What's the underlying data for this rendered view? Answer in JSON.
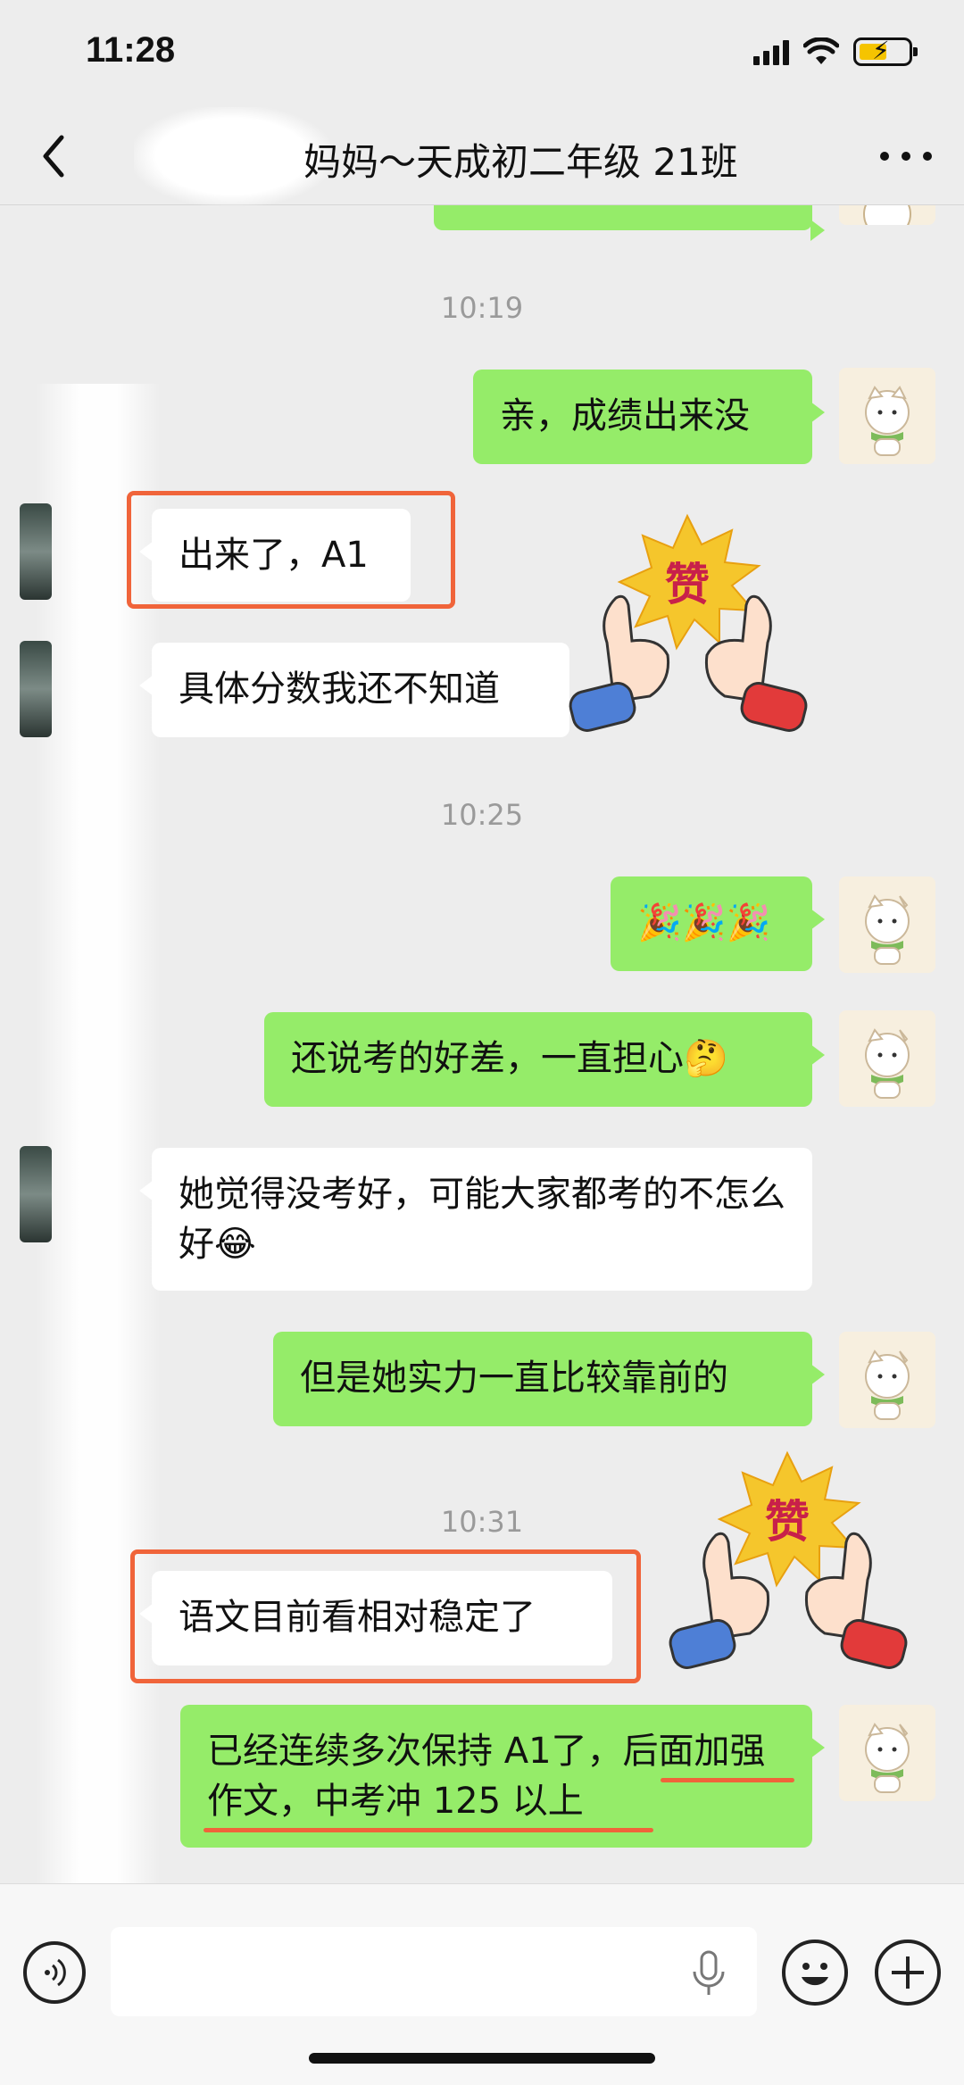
{
  "status_bar": {
    "time": "11:28"
  },
  "nav": {
    "title": "妈妈～天成初二年级 21班"
  },
  "chat": {
    "timestamps": [
      "10:19",
      "10:25",
      "10:31"
    ],
    "messages": [
      {
        "side": "out",
        "text": "亲，成绩出来没"
      },
      {
        "side": "in",
        "text": "出来了，A1",
        "highlighted": true
      },
      {
        "side": "in",
        "text": "具体分数我还不知道"
      },
      {
        "side": "out",
        "text": "🎉🎉🎉"
      },
      {
        "side": "out",
        "text": "还说考的好差，一直担心🤔"
      },
      {
        "side": "in",
        "text": "她觉得没考好，可能大家都考的不怎么好😂"
      },
      {
        "side": "out",
        "text": "但是她实力一直比较靠前的"
      },
      {
        "side": "in",
        "text": "语文目前看相对稳定了",
        "highlighted": true
      },
      {
        "side": "out",
        "text": "已经连续多次保持 A1了，后面加强作文，中考冲 125 以上"
      }
    ],
    "stickers": [
      {
        "icon": "thumbs-up-zan-sticker",
        "text": "赞"
      },
      {
        "icon": "thumbs-up-zan-sticker",
        "text": "赞"
      }
    ]
  },
  "input_bar": {
    "placeholder": ""
  },
  "colors": {
    "background": "#ededed",
    "outgoing_bubble": "#95ec69",
    "incoming_bubble": "#ffffff",
    "annotation": "#f0643a"
  }
}
